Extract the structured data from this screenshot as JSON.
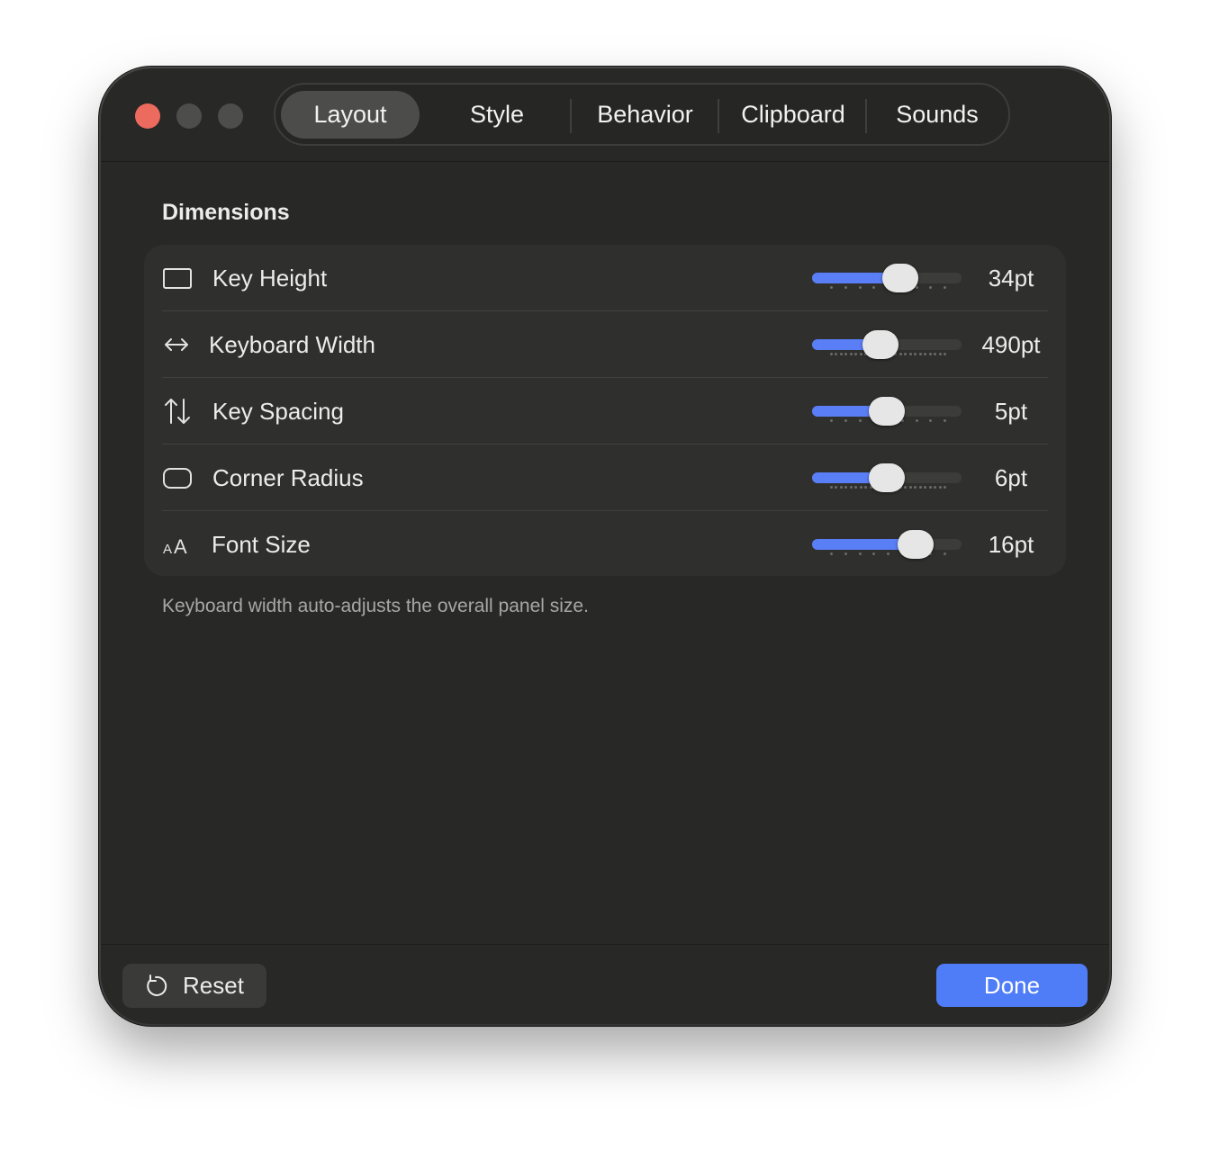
{
  "tabs": [
    {
      "label": "Layout",
      "active": true
    },
    {
      "label": "Style",
      "active": false
    },
    {
      "label": "Behavior",
      "active": false
    },
    {
      "label": "Clipboard",
      "active": false
    },
    {
      "label": "Sounds",
      "active": false
    }
  ],
  "section_title": "Dimensions",
  "settings": [
    {
      "label": "Key Height",
      "icon": "rectangle-icon",
      "value": "34pt",
      "slider_fraction": 0.59
    },
    {
      "label": "Keyboard Width",
      "icon": "arrow-left-right-icon",
      "value": "490pt",
      "slider_fraction": 0.46
    },
    {
      "label": "Key Spacing",
      "icon": "arrow-up-down-icon",
      "value": "5pt",
      "slider_fraction": 0.5
    },
    {
      "label": "Corner Radius",
      "icon": "rounded-rectangle-icon",
      "value": "6pt",
      "slider_fraction": 0.5
    },
    {
      "label": "Font Size",
      "icon": "text-size-icon",
      "value": "16pt",
      "slider_fraction": 0.69
    }
  ],
  "footnote": "Keyboard width auto-adjusts the overall panel size.",
  "buttons": {
    "reset": "Reset",
    "done": "Done"
  },
  "colors": {
    "accent": "#4f7cf7",
    "close": "#ed6a5e",
    "background": "#282827"
  }
}
